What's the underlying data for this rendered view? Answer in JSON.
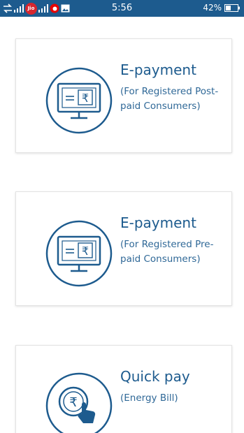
{
  "status_bar": {
    "carrier": "Jio",
    "time": "5:56",
    "battery": "42%",
    "icons": [
      "transfer-arrows-icon",
      "signal-icon",
      "jio-icon",
      "signal-icon",
      "vodafone-icon",
      "gallery-icon",
      "battery-icon"
    ]
  },
  "cards": [
    {
      "title": "E-payment",
      "subtitle": "(For Registered Post-paid Consumers)",
      "icon": "monitor-rupee-icon"
    },
    {
      "title": "E-payment",
      "subtitle": "(For Registered Pre-paid Consumers)",
      "icon": "monitor-rupee-icon"
    },
    {
      "title": "Quick pay",
      "subtitle": "(Energy Bill)",
      "icon": "coin-tap-icon"
    }
  ],
  "colors": {
    "status_bar": "#1d5b8e",
    "accent": "#1d5b8e"
  }
}
